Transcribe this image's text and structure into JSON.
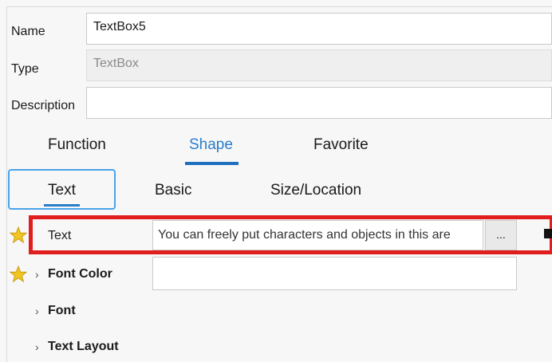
{
  "properties": {
    "name_label": "Name",
    "name_value": "TextBox5",
    "type_label": "Type",
    "type_value": "TextBox",
    "description_label": "Description",
    "description_value": ""
  },
  "tabs": [
    {
      "label": "Function"
    },
    {
      "label": "Shape"
    },
    {
      "label": "Favorite"
    }
  ],
  "subtabs": [
    {
      "label": "Text"
    },
    {
      "label": "Basic"
    },
    {
      "label": "Size/Location"
    }
  ],
  "rows": {
    "text": {
      "label": "Text",
      "value": "You can freely put characters and objects in this are",
      "button": "..."
    },
    "font_color": {
      "label": "Font Color"
    },
    "font": {
      "label": "Font"
    },
    "text_layout": {
      "label": "Text Layout"
    }
  },
  "icons": {
    "star": "star-icon",
    "chevron": "chevron-right-icon"
  },
  "colors": {
    "accent": "#2a7dc9",
    "highlight": "#e01e1e",
    "star": "#f2c41f"
  }
}
